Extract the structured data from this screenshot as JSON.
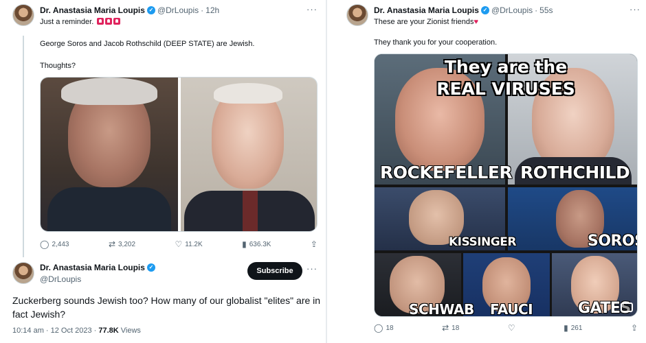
{
  "left_tweet": {
    "author_name": "Dr. Anastasia Maria Loupis",
    "handle": "@DrLoupis",
    "time": "12h",
    "line1": "Just a reminder.",
    "line2": "George Soros and Jacob Rothschild (DEEP STATE) are Jewish.",
    "line3": "Thoughts?",
    "actions": {
      "replies": "2,443",
      "reposts": "3,202",
      "likes": "11.2K",
      "views": "636.3K"
    }
  },
  "reply_tweet": {
    "author_name": "Dr. Anastasia Maria Loupis",
    "handle": "@DrLoupis",
    "subscribe_label": "Subscribe",
    "text": "Zuckerberg sounds Jewish too? How many of our globalist \"elites\" are in fact Jewish?",
    "time_date": "10:14 am · 12 Oct 2023 · ",
    "views_count": "77.8K",
    "views_label": " Views"
  },
  "right_tweet": {
    "author_name": "Dr. Anastasia Maria Loupis",
    "handle": "@DrLoupis",
    "time": "55s",
    "line1": "These are your Zionist friends",
    "line2": "They thank you for your cooperation.",
    "meme": {
      "headline1": "They are the",
      "headline2": "REAL VIRUSES",
      "captions": [
        "ROCKEFELLER",
        "ROTHCHILD",
        "KISSINGER",
        "SOROS",
        "SCHWAB",
        "FAUCI",
        "GATES"
      ]
    },
    "actions": {
      "replies": "18",
      "reposts": "18",
      "views": "261"
    }
  },
  "colors": {
    "accent": "#1d9bf0",
    "text": "#0f1419",
    "muted": "#536471"
  }
}
